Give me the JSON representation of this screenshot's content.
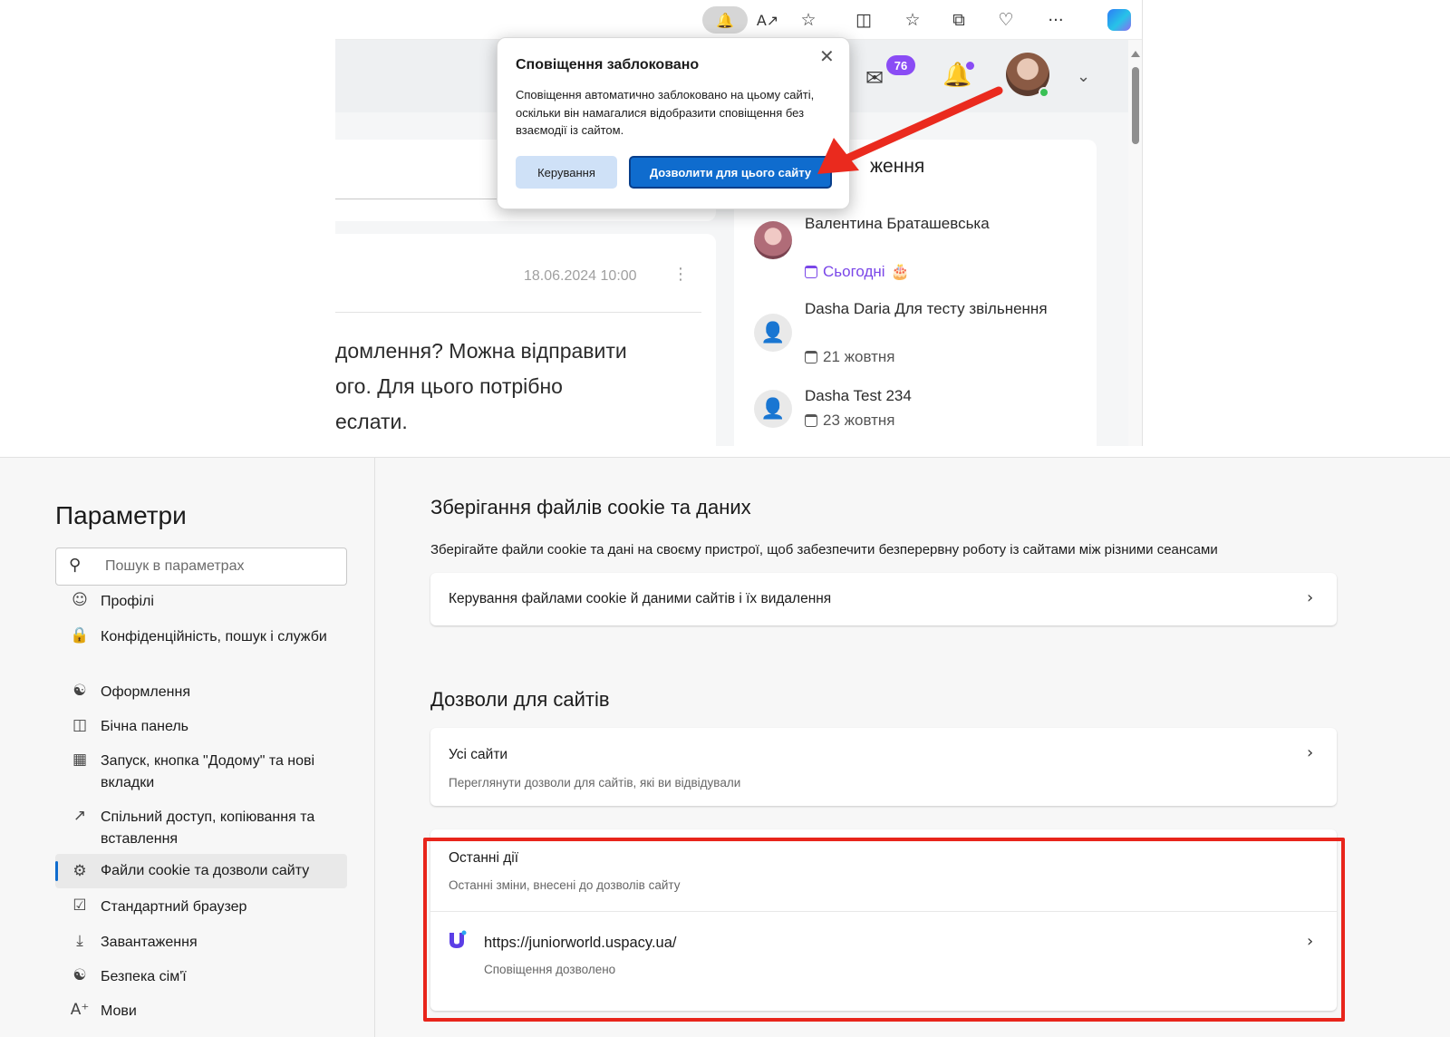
{
  "browser": {
    "toolbar_icons": [
      "bell-icon",
      "read-aloud-icon",
      "favorite-star-icon",
      "split-screen-icon",
      "favorites-list-icon",
      "collections-icon",
      "browser-essentials-icon",
      "more-icon",
      "copilot-icon"
    ],
    "toolbar_glyphs": {
      "read_aloud": "A↗",
      "more": "···"
    }
  },
  "app": {
    "mail_badge": "76",
    "post": {
      "date": "18.06.2024 10:00",
      "text_lines": [
        "домлення? Можна відправити",
        "ого. Для цього потрібно",
        "еслати."
      ]
    },
    "birthdays": {
      "title_fragment": "ження",
      "people": [
        {
          "name": "Валентина Браташевська",
          "date": "Сьогодні",
          "cake": "🎂"
        },
        {
          "name": "Dasha Daria Для тесту звільнення",
          "date": "21 жовтня"
        },
        {
          "name": "Dasha Test 234",
          "date": "23 жовтня"
        }
      ]
    }
  },
  "popup": {
    "title": "Сповіщення заблоковано",
    "body": "Сповіщення автоматично заблоковано на цьому сайті, оскільки він намагалися відобразити сповіщення без взаємодії із сайтом.",
    "manage_label": "Керування",
    "allow_label": "Дозволити для цього сайту"
  },
  "settings": {
    "title": "Параметри",
    "search_placeholder": "Пошук в параметрах",
    "nav": [
      {
        "label": "Профілі",
        "icon": "profile-icon"
      },
      {
        "label": "Конфіденційність, пошук і служби",
        "icon": "lock-icon"
      },
      {
        "label": "Оформлення",
        "icon": "palette-icon"
      },
      {
        "label": "Бічна панель",
        "icon": "sidebar-icon"
      },
      {
        "label": "Запуск, кнопка \"Додому\" та нові вкладки",
        "icon": "start-page-icon"
      },
      {
        "label": "Спільний доступ, копіювання та вставлення",
        "icon": "share-icon"
      },
      {
        "label": "Файли cookie та дозволи сайту",
        "icon": "cookie-settings-icon",
        "active": true
      },
      {
        "label": "Стандартний браузер",
        "icon": "default-browser-icon"
      },
      {
        "label": "Завантаження",
        "icon": "download-icon"
      },
      {
        "label": "Безпека сім'ї",
        "icon": "family-icon"
      },
      {
        "label": "Мови",
        "icon": "languages-icon"
      }
    ],
    "cookies": {
      "heading": "Зберігання файлів cookie та даних",
      "description": "Зберігайте файли cookie та дані на своєму пристрої, щоб забезпечити безперервну роботу із сайтами між різними сеансами",
      "manage_row": "Керування файлами cookie й даними сайтів і їх видалення"
    },
    "permissions": {
      "heading": "Дозволи для сайтів",
      "all_sites_label": "Усі сайти",
      "all_sites_sub": "Переглянути дозволи для сайтів, які ви відвідували",
      "recent_label": "Останні дії",
      "recent_sub": "Останні зміни, внесені до дозволів сайту",
      "site_url": "https://juniorworld.uspacy.ua/",
      "site_status": "Сповіщення дозволено"
    }
  },
  "colors": {
    "accent": "#0f6cce",
    "highlight": "#e8251b",
    "badge": "#8a4cf5"
  }
}
